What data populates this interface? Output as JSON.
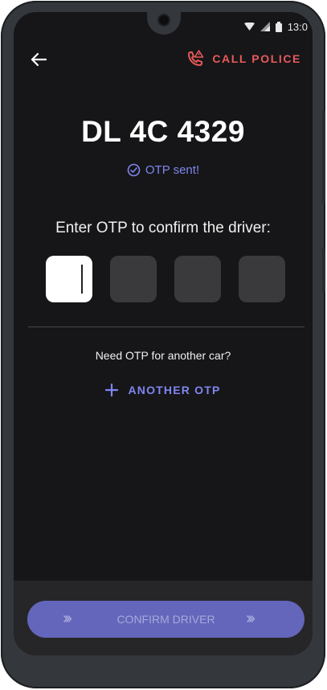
{
  "status_bar": {
    "time": "13:0"
  },
  "header": {
    "back_icon": "arrow-left-icon",
    "call_police_label": "CALL POLICE",
    "call_police_icon": "phone-alert-icon"
  },
  "vehicle": {
    "plate": "DL 4C 4329"
  },
  "otp_status": {
    "text": "OTP sent!",
    "icon": "check-circle-icon"
  },
  "prompt": "Enter OTP to confirm the driver:",
  "otp_inputs": [
    {
      "value": ""
    },
    {
      "value": ""
    },
    {
      "value": ""
    },
    {
      "value": ""
    }
  ],
  "another_car": {
    "question": "Need OTP for another car?",
    "button_label": "ANOTHER OTP",
    "icon": "plus-icon"
  },
  "footer": {
    "confirm_label": "CONFIRM DRIVER",
    "chevrons": "›››"
  },
  "colors": {
    "accent": "#7f86f0",
    "danger": "#e8595a",
    "background": "#161618",
    "confirm_bg": "#6366ba"
  }
}
